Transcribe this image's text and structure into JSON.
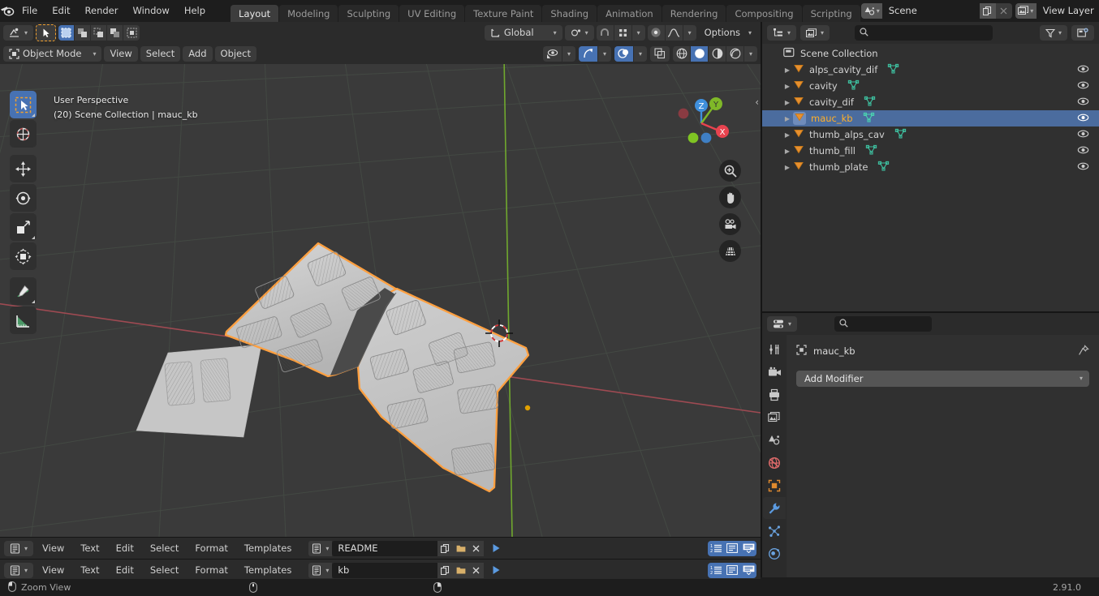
{
  "app": {
    "name": "Blender",
    "version": "2.91.0"
  },
  "topbar": {
    "menus": [
      "File",
      "Edit",
      "Render",
      "Window",
      "Help"
    ],
    "workspaces": [
      {
        "label": "Layout",
        "active": true
      },
      {
        "label": "Modeling",
        "active": false
      },
      {
        "label": "Sculpting",
        "active": false
      },
      {
        "label": "UV Editing",
        "active": false
      },
      {
        "label": "Texture Paint",
        "active": false
      },
      {
        "label": "Shading",
        "active": false
      },
      {
        "label": "Animation",
        "active": false
      },
      {
        "label": "Rendering",
        "active": false
      },
      {
        "label": "Compositing",
        "active": false
      },
      {
        "label": "Scripting",
        "active": false
      }
    ],
    "scene_field": {
      "value": "Scene",
      "icon": "scene-icon",
      "new_icon": "duplicate-icon",
      "unlink_icon": "x-icon"
    },
    "viewlayer_field": {
      "value": "View Layer",
      "icon": "viewlayer-icon",
      "new_icon": "duplicate-icon",
      "unlink_icon": "x-icon"
    }
  },
  "viewport": {
    "header_row1": {
      "editor_type_icon": "editor-type-icon",
      "select_tool_icon": "cursor-select-icon",
      "select_modes": [
        "select-new-icon",
        "select-extend-icon",
        "select-subtract-icon",
        "select-invert-icon",
        "select-intersect-icon"
      ],
      "transform_orientation": "Global",
      "orientation_icon": "orientation-icon",
      "pivot_icon": "pivot-point-icon",
      "snap_icon": "snap-magnet-icon",
      "snap_to_icon": "snap-increment-icon",
      "proportional_icon": "proportional-edit-icon",
      "falloff_icon": "falloff-curve-icon",
      "options_label": "Options"
    },
    "header_row2": {
      "mode": "Object Mode",
      "mode_icon": "object-mode-icon",
      "menus": [
        "View",
        "Select",
        "Add",
        "Object"
      ],
      "visibility_icon": "show-hide-icon",
      "gizmo_icon": "gizmo-icon",
      "overlays_icon": "overlays-icon",
      "xray_icon": "x-ray-icon",
      "shading_modes": [
        "wireframe-icon",
        "solid-icon",
        "material-preview-icon",
        "rendered-icon"
      ],
      "shading_active_index": 1
    },
    "info": {
      "line1": "User Perspective",
      "line2": "(20) Scene Collection | mauc_kb"
    },
    "toolbar": [
      {
        "name": "tweak-select-box-tool",
        "icon": "select-box-icon",
        "active": true
      },
      {
        "name": "cursor-tool",
        "icon": "3d-cursor-icon",
        "active": false
      },
      {
        "name": "move-tool",
        "icon": "move-arrows-icon",
        "active": false
      },
      {
        "name": "rotate-tool",
        "icon": "rotate-icon",
        "active": false
      },
      {
        "name": "scale-tool",
        "icon": "scale-icon",
        "active": false
      },
      {
        "name": "transform-tool",
        "icon": "transform-icon",
        "active": false
      },
      {
        "name": "annotate-tool",
        "icon": "pencil-icon",
        "active": false
      },
      {
        "name": "measure-tool",
        "icon": "ruler-icon",
        "active": false
      }
    ],
    "gizmo_axes": [
      {
        "label": "Z",
        "color": "#3f8fdc"
      },
      {
        "label": "Y",
        "color": "#7fb828"
      },
      {
        "label": "X",
        "color": "#e8434f"
      }
    ],
    "nav_buttons": [
      "zoom-icon",
      "pan-hand-icon",
      "camera-icon",
      "ortho-persp-grid-icon"
    ],
    "model": {
      "name": "mauc_kb",
      "selected": true,
      "outline_color": "#ffa040",
      "surface_color": "#c9c9c9"
    }
  },
  "outliner": {
    "header": {
      "display_mode_icon": "outliner-display-mode-icon",
      "filter_id_icon": "scene-filter-icon",
      "search_placeholder": "",
      "search_icon": "search-icon",
      "filter_icon": "funnel-filter-icon",
      "new_collection_icon": "new-collection-icon"
    },
    "root": {
      "label": "Scene Collection",
      "icon": "collection-icon"
    },
    "items": [
      {
        "label": "alps_cavity_dif",
        "icon": "mesh-object-icon",
        "data_icon": "mesh-data-icon",
        "selected": false,
        "visible": true
      },
      {
        "label": "cavity",
        "icon": "mesh-object-icon",
        "data_icon": "mesh-data-icon",
        "selected": false,
        "visible": true
      },
      {
        "label": "cavity_dif",
        "icon": "mesh-object-icon",
        "data_icon": "mesh-data-icon",
        "selected": false,
        "visible": true
      },
      {
        "label": "mauc_kb",
        "icon": "mesh-object-icon",
        "data_icon": "mesh-data-icon",
        "selected": true,
        "visible": true
      },
      {
        "label": "thumb_alps_cav",
        "icon": "mesh-object-icon",
        "data_icon": "mesh-data-icon",
        "selected": false,
        "visible": true
      },
      {
        "label": "thumb_fill",
        "icon": "mesh-object-icon",
        "data_icon": "mesh-data-icon",
        "selected": false,
        "visible": true
      },
      {
        "label": "thumb_plate",
        "icon": "mesh-object-icon",
        "data_icon": "mesh-data-icon",
        "selected": false,
        "visible": true
      }
    ]
  },
  "properties": {
    "header": {
      "editor_type_icon": "properties-editor-icon",
      "search_placeholder": "",
      "search_icon": "search-icon"
    },
    "tabs": [
      {
        "name": "tool",
        "icon": "tool-icon",
        "active": false
      },
      {
        "name": "render",
        "icon": "render-camera-icon",
        "active": false
      },
      {
        "name": "output",
        "icon": "printer-output-icon",
        "active": false
      },
      {
        "name": "view-layer",
        "icon": "view-layer-images-icon",
        "active": false
      },
      {
        "name": "scene",
        "icon": "scene-cone-icon",
        "active": false
      },
      {
        "name": "world",
        "icon": "world-globe-icon",
        "active": false
      },
      {
        "name": "object",
        "icon": "object-square-icon",
        "active": false
      },
      {
        "name": "modifiers",
        "icon": "wrench-icon",
        "active": true
      },
      {
        "name": "particles",
        "icon": "particles-icon",
        "active": false
      },
      {
        "name": "physics",
        "icon": "physics-orbit-icon",
        "active": false
      }
    ],
    "breadcrumb": {
      "object_name": "mauc_kb",
      "icon": "object-square-icon",
      "pin_icon": "pin-icon"
    },
    "add_modifier_label": "Add Modifier"
  },
  "text_editors": [
    {
      "editor_type_icon": "text-editor-icon",
      "menus": [
        "View",
        "Text",
        "Edit",
        "Select",
        "Format",
        "Templates"
      ],
      "datablock_icon": "text-datablock-icon",
      "filename": "README",
      "new_icon": "new-text-icon",
      "open_icon": "open-folder-icon",
      "unlink_icon": "x-icon",
      "run_icon": "run-script-icon",
      "toggles": [
        {
          "name": "line-numbers",
          "icon": "line-numbers-icon",
          "on": true
        },
        {
          "name": "word-wrap",
          "icon": "word-wrap-icon",
          "on": true
        },
        {
          "name": "syntax-highlight",
          "icon": "syntax-highlight-icon",
          "on": true
        }
      ]
    },
    {
      "editor_type_icon": "text-editor-icon",
      "menus": [
        "View",
        "Text",
        "Edit",
        "Select",
        "Format",
        "Templates"
      ],
      "datablock_icon": "text-datablock-icon",
      "filename": "kb",
      "new_icon": "new-text-icon",
      "open_icon": "open-folder-icon",
      "unlink_icon": "x-icon",
      "run_icon": "run-script-icon",
      "toggles": [
        {
          "name": "line-numbers",
          "icon": "line-numbers-icon",
          "on": true
        },
        {
          "name": "word-wrap",
          "icon": "word-wrap-icon",
          "on": true
        },
        {
          "name": "syntax-highlight",
          "icon": "syntax-highlight-icon",
          "on": true
        }
      ]
    }
  ],
  "status_bar": {
    "mouse_left_icon": "mouse-left-button-icon",
    "action_label": "Zoom View",
    "mouse_middle_icon": "mouse-middle-button-icon",
    "mouse_right_icon": "mouse-right-button-icon",
    "version": "2.91.0"
  },
  "colors": {
    "accent_blue": "#4772b3",
    "selection_orange": "#ffaf29",
    "header_bg": "#2b2b2b",
    "editor_bg": "#303030",
    "viewport_bg": "#3a3a3a"
  }
}
